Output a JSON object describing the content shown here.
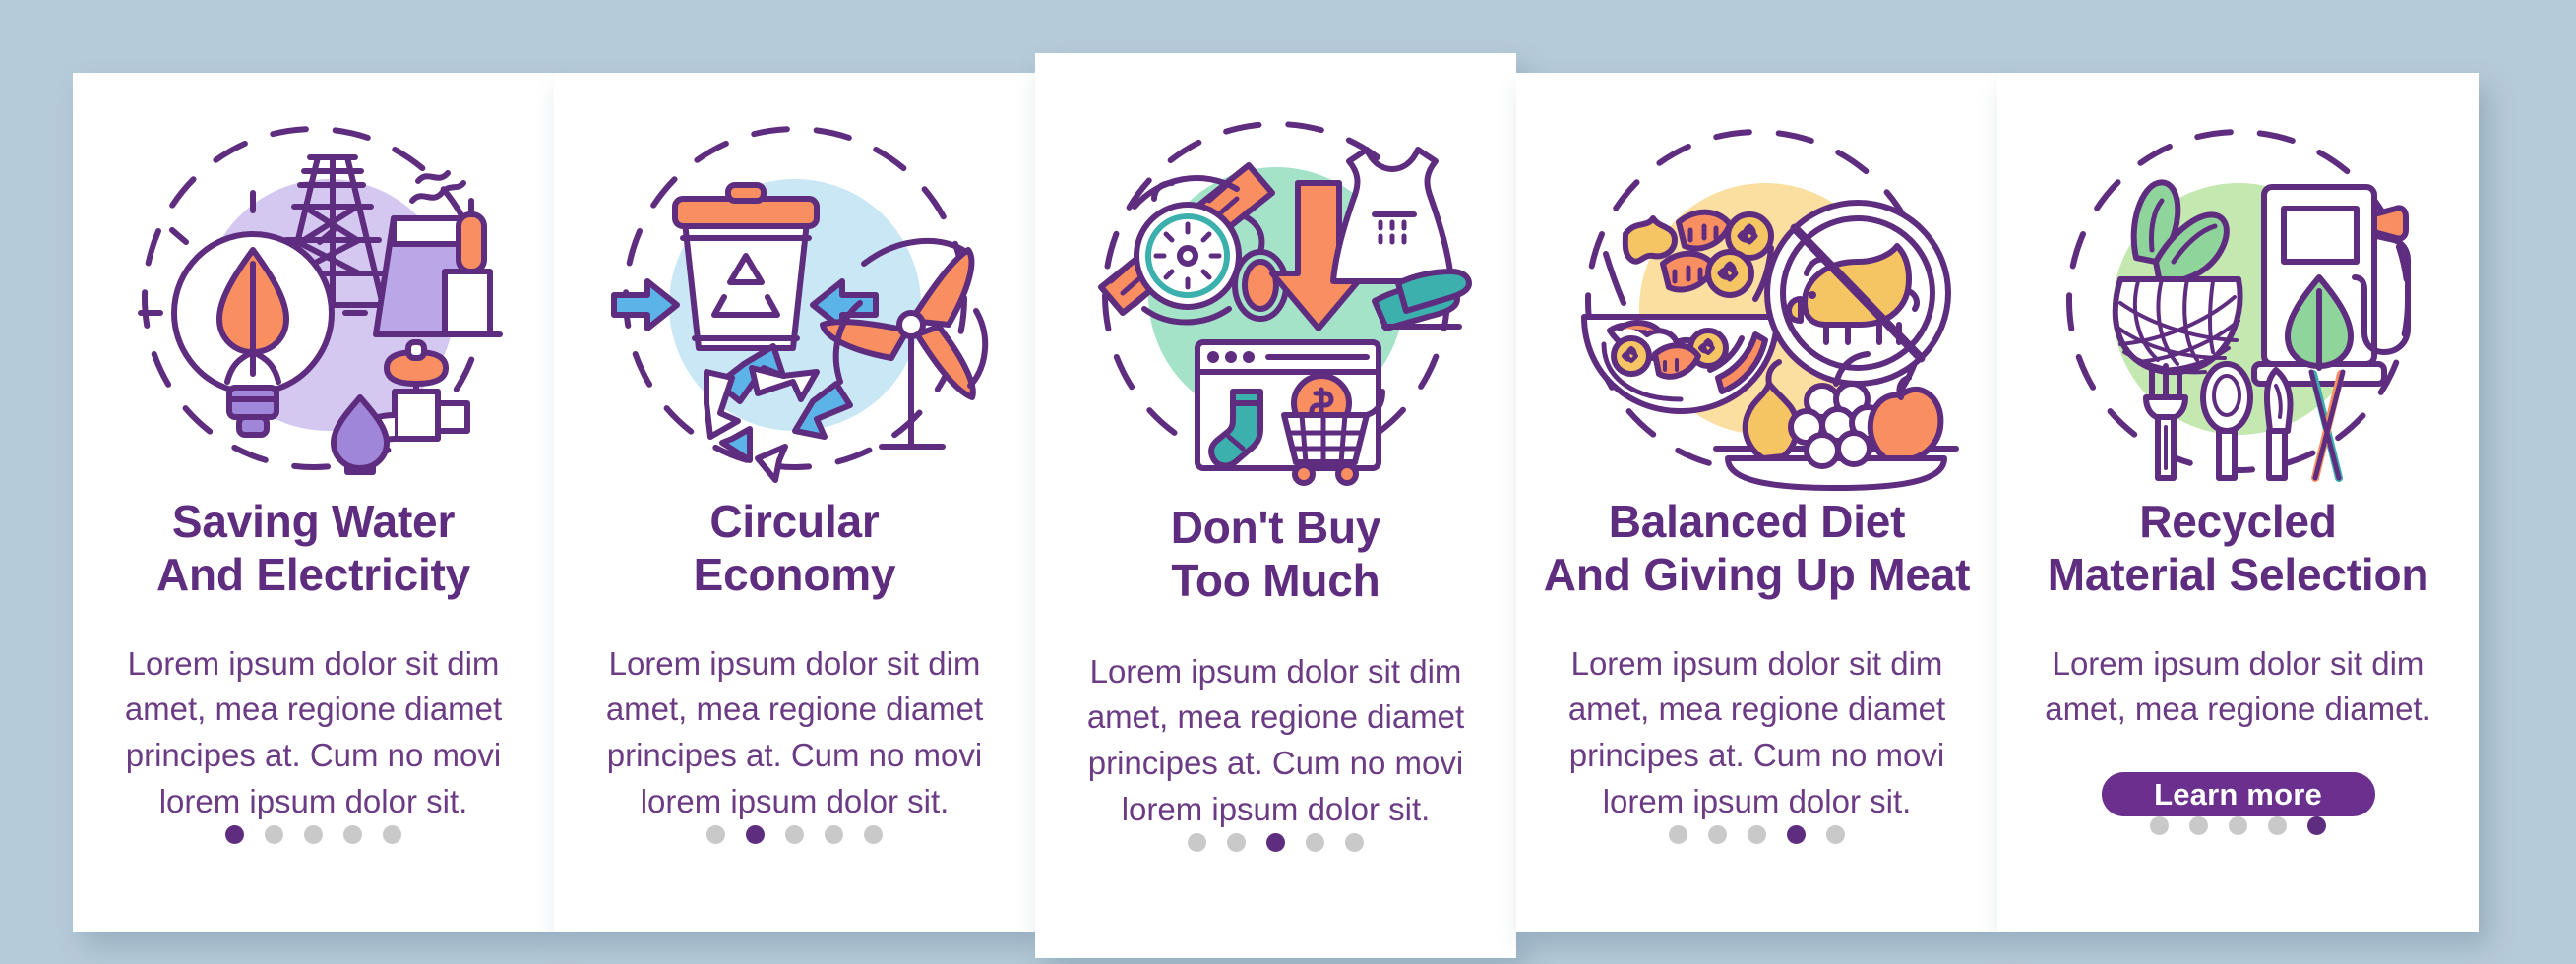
{
  "theme": {
    "background": "#b6cbd9",
    "card_background": "#ffffff",
    "accent_purple": "#5f2d7f",
    "button_purple": "#6b2f8e",
    "body_text": "#6b3b84",
    "dot_inactive": "#c9c9c9",
    "orange": "#f98e61",
    "blue": "#5cb3e8",
    "teal": "#3bb0ad",
    "yellow": "#f6c563",
    "green": "#8fd49a"
  },
  "screens": [
    {
      "id": "saving-water-and-electricity",
      "title": "Saving Water\nAnd Electricity",
      "body": "Lorem ipsum dolor sit dim\namet, mea regione diamet\nprincipes at. Cum no movi\nlorem ipsum dolor sit.",
      "illustration_name": "saving-water-electricity-illustration",
      "blob_color": "#d5c8f0",
      "dots": {
        "count": 5,
        "active_index": 0
      },
      "cta": null
    },
    {
      "id": "circular-economy",
      "title": "Circular\nEconomy",
      "body": "Lorem ipsum dolor sit dim\namet, mea regione diamet\nprincipes at. Cum no movi\nlorem ipsum dolor sit.",
      "illustration_name": "circular-economy-illustration",
      "blob_color": "#c9e7f5",
      "dots": {
        "count": 5,
        "active_index": 1
      },
      "cta": null
    },
    {
      "id": "dont-buy-too-much",
      "title": "Don't Buy\nToo Much",
      "body": "Lorem ipsum dolor sit dim\namet, mea regione diamet\nprincipes at. Cum no movi\nlorem ipsum dolor sit.",
      "illustration_name": "dont-buy-too-much-illustration",
      "blob_color": "#a5e3c9",
      "dots": {
        "count": 5,
        "active_index": 2
      },
      "cta": null
    },
    {
      "id": "balanced-diet-and-giving-up-meat",
      "title": "Balanced Diet\nAnd Giving Up Meat",
      "body": "Lorem ipsum dolor sit dim\namet, mea regione diamet\nprincipes at. Cum no movi\nlorem ipsum dolor sit.",
      "illustration_name": "balanced-diet-illustration",
      "blob_color": "#fbdfa0",
      "dots": {
        "count": 5,
        "active_index": 3
      },
      "cta": null
    },
    {
      "id": "recycled-material-selection",
      "title": "Recycled\nMaterial Selection",
      "body": "Lorem ipsum dolor sit dim\namet, mea regione diamet.",
      "illustration_name": "recycled-material-illustration",
      "blob_color": "#c4e9b0",
      "dots": {
        "count": 5,
        "active_index": 4
      },
      "cta": {
        "label": "Learn more"
      }
    }
  ]
}
